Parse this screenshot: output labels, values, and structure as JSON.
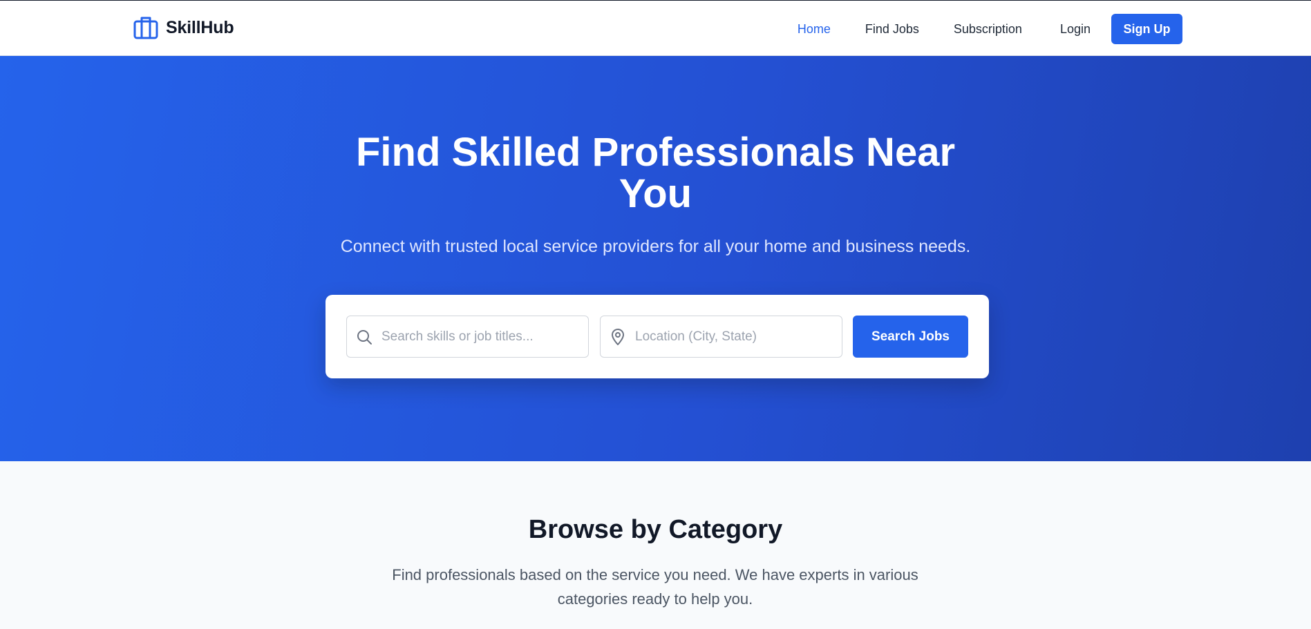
{
  "brand": {
    "name": "SkillHub",
    "icon": "briefcase-icon",
    "color": "#2563eb"
  },
  "nav": {
    "items": [
      {
        "label": "Home",
        "active": true
      },
      {
        "label": "Find Jobs",
        "active": false
      },
      {
        "label": "Subscription",
        "active": false
      },
      {
        "label": "Login",
        "active": false
      }
    ],
    "signup_label": "Sign Up"
  },
  "hero": {
    "title_line1": "Find Skilled Professionals Near",
    "title_line2": "You",
    "subtitle": "Connect with trusted local service providers for all your home and business needs.",
    "search": {
      "skills_placeholder": "Search skills or job titles...",
      "skills_value": "",
      "skills_icon": "search-icon",
      "location_placeholder": "Location (City, State)",
      "location_value": "",
      "location_icon": "map-pin-icon",
      "button_label": "Search Jobs"
    }
  },
  "categories": {
    "title": "Browse by Category",
    "subtitle": "Find professionals based on the service you need. We have experts in various categories ready to help you."
  },
  "colors": {
    "accent": "#2563eb",
    "hero_start": "#2563eb",
    "hero_end": "#1e40af",
    "text_dark": "#111827"
  }
}
